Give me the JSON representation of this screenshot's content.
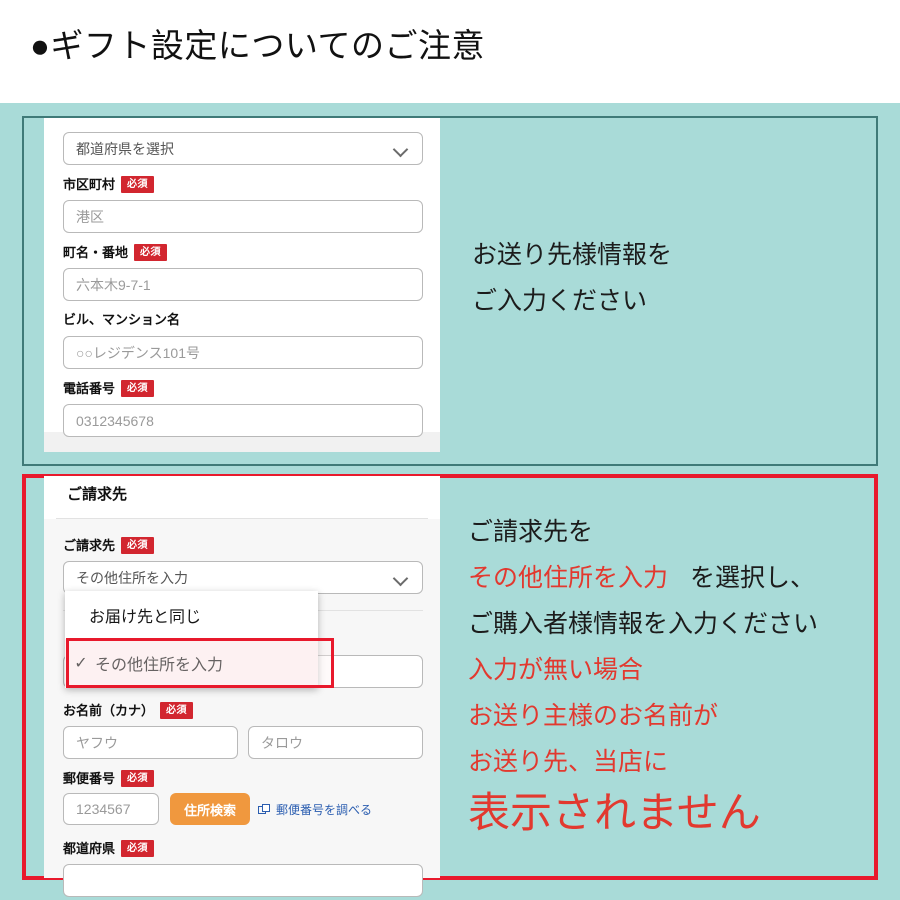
{
  "heading": "●ギフト設定についてのご注意",
  "colors": {
    "teal_background": "#a9dbd8",
    "red_accent": "#e8192c",
    "red_text": "#e2392f",
    "required_badge": "#d2262f",
    "orange_button": "#f0983e",
    "link_blue": "#2a5db0",
    "top_box_border": "#3f7a78"
  },
  "shipping_form": {
    "prefecture_select": {
      "value": "都道府県を選択",
      "chevron": "chevron-down-icon"
    },
    "city": {
      "label": "市区町村",
      "required_badge": "必須",
      "placeholder": "港区"
    },
    "town_address": {
      "label": "町名・番地",
      "required_badge": "必須",
      "placeholder": "六本木9-7-1"
    },
    "building": {
      "label": "ビル、マンション名",
      "required_badge": "",
      "placeholder": "○○レジデンス101号"
    },
    "phone": {
      "label": "電話番号",
      "required_badge": "必須",
      "placeholder": "0312345678"
    }
  },
  "shipping_annotation": {
    "line1": "お送り先様情報を",
    "line2": "ご入力ください"
  },
  "billing_form": {
    "section_title": "ご請求先",
    "billing_select": {
      "label": "ご請求先",
      "required_badge": "必須",
      "value": "その他住所を入力",
      "chevron": "chevron-down-icon",
      "options": [
        {
          "label": "お届け先と同じ",
          "selected": false,
          "check": ""
        },
        {
          "label": "その他住所を入力",
          "selected": true,
          "check": "✓"
        }
      ]
    },
    "name_kana": {
      "label": "お名前（カナ）",
      "required_badge": "必須",
      "placeholder_last": "ヤフウ",
      "placeholder_first": "タロウ"
    },
    "postal_code": {
      "label": "郵便番号",
      "required_badge": "必須",
      "placeholder": "1234567",
      "search_button": "住所検索",
      "lookup_link": "郵便番号を調べる",
      "lookup_icon": "external-window-icon"
    },
    "prefecture": {
      "label": "都道府県",
      "required_badge": "必須"
    }
  },
  "billing_annotation": {
    "line1": "ご請求先を",
    "line2_red": "その他住所を入力",
    "line2_rest": "を選択し、",
    "line3": "ご購入者様情報を入力ください",
    "line4_red": "入力が無い場合",
    "line5_red": "お送り主様のお名前が",
    "line6_red": "お送り先、当店に",
    "line7_big_red": "表示されません"
  }
}
